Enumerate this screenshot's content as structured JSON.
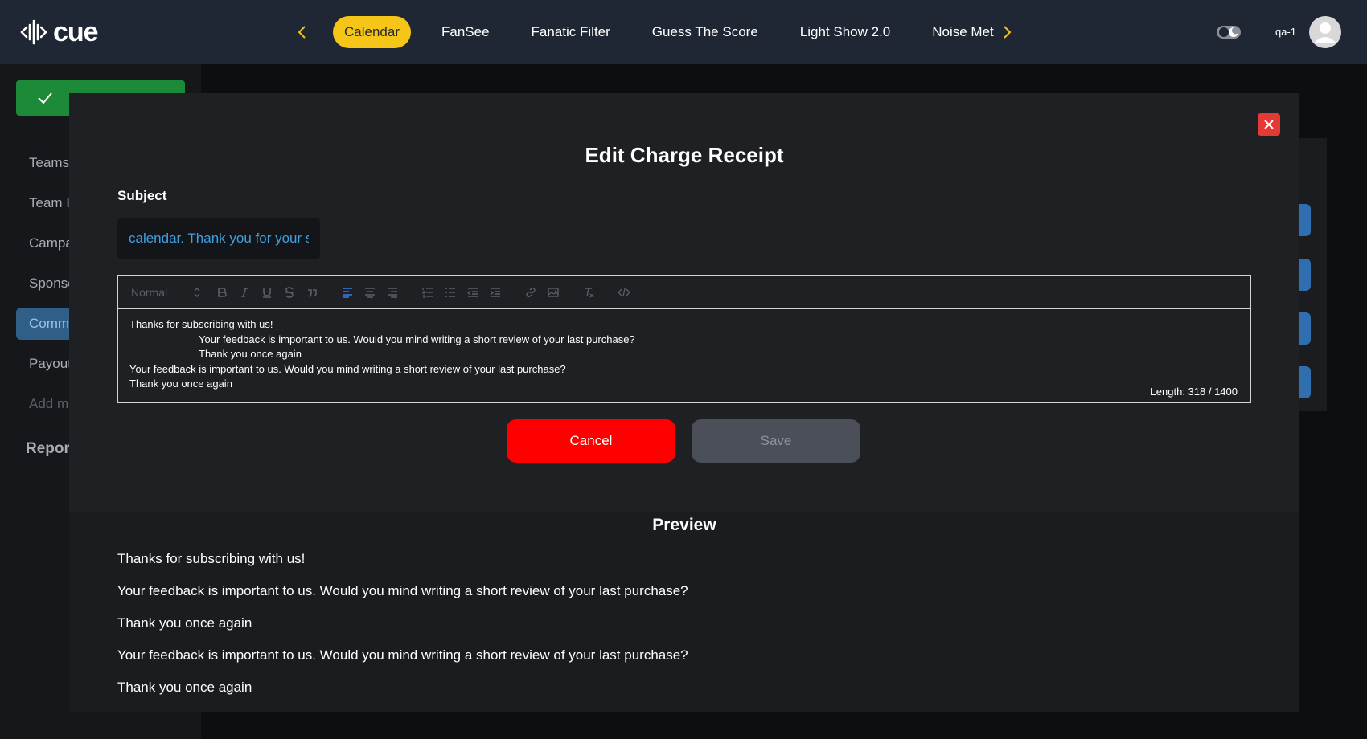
{
  "header": {
    "logo_text": "cue",
    "tabs": [
      {
        "label": "Calendar",
        "active": true
      },
      {
        "label": "FanSee",
        "active": false
      },
      {
        "label": "Fanatic Filter",
        "active": false
      },
      {
        "label": "Guess The Score",
        "active": false
      },
      {
        "label": "Light Show 2.0",
        "active": false
      },
      {
        "label": "Noise Met",
        "active": false
      }
    ],
    "user_name": "qa-1",
    "accent_color": "#f5c518"
  },
  "sidebar": {
    "items": [
      "Teams",
      "Team I",
      "Campa",
      "Sponso",
      "Comm",
      "Payout",
      "Add m"
    ],
    "section_label": "Report"
  },
  "modal": {
    "title": "Edit Charge Receipt",
    "subject_label": "Subject",
    "subject_value": "calendar. Thank you for your s",
    "toolbar": {
      "header_select": "Normal"
    },
    "editor_lines": {
      "line1": "Thanks for subscribing with us!",
      "line2": "Your feedback is important to us. Would you mind writing a short review of your last purchase?",
      "line3": "Thank you once again",
      "line4": "Your feedback is important to us. Would you mind writing a short review of your last purchase?",
      "line5": "Thank you once again"
    },
    "length_label": "Length: 318 / 1400",
    "cancel_label": "Cancel",
    "save_label": "Save",
    "preview_title": "Preview",
    "preview_lines": {
      "line1": "Thanks for subscribing with us!",
      "line2": "Your feedback is important to us. Would you mind writing a short review of your last purchase?",
      "line3": "Thank you once again",
      "line4": "Your feedback is important to us. Would you mind writing a short review of your last purchase?",
      "line5": "Thank you once again"
    }
  }
}
